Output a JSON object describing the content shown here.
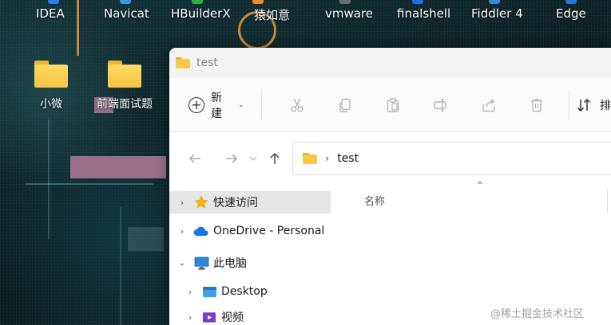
{
  "desktop": {
    "apps": [
      {
        "label": "IDEA",
        "color": "#2d7cf0"
      },
      {
        "label": "Navicat",
        "color": "#3f9ad9"
      },
      {
        "label": "HBuilderX",
        "color": "#2fb24c"
      },
      {
        "label": "猿如意",
        "color": "#e98b2a"
      },
      {
        "label": "vmware",
        "color": "#6e6e6e"
      },
      {
        "label": "finalshell",
        "color": "#1d6fe0"
      },
      {
        "label": "Fiddler 4",
        "color": "#3b8ad8"
      },
      {
        "label": "Edge",
        "color": "#1f7ad9"
      }
    ],
    "folders": [
      {
        "label": "小微"
      },
      {
        "label": "前端面试题"
      }
    ]
  },
  "window": {
    "title": "test",
    "toolbar": {
      "new_label": "新建",
      "sort_label": "排"
    },
    "address": {
      "path": "test"
    },
    "navpane": {
      "items": [
        {
          "label": "快速访问",
          "icon": "star-icon"
        },
        {
          "label": "OneDrive - Personal",
          "icon": "cloud-icon"
        },
        {
          "label": "此电脑",
          "icon": "monitor-icon"
        },
        {
          "label": "Desktop",
          "icon": "desktop-folder-icon"
        },
        {
          "label": "视频",
          "icon": "video-folder-icon"
        }
      ]
    },
    "content": {
      "column_name": "名称"
    }
  },
  "watermark": "@稀土掘金技术社区"
}
